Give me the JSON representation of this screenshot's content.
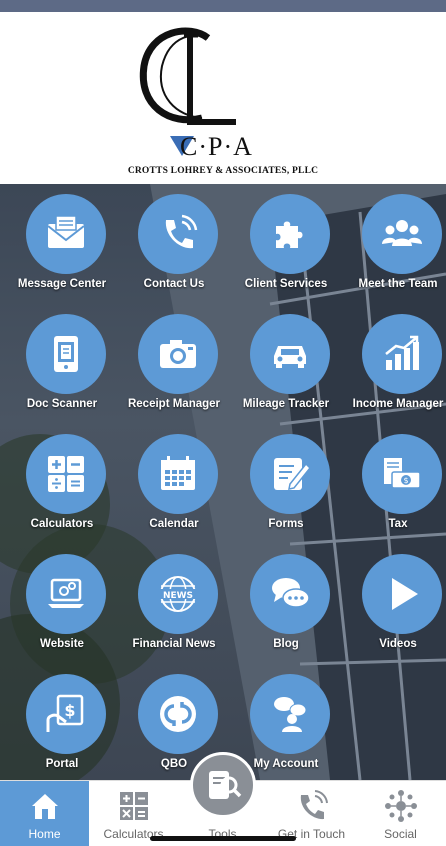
{
  "header": {
    "logo_monogram": "CL",
    "logo_cpa": "C·P·A",
    "firm_name": "CROTTS LOHREY & ASSOCIATES, PLLC"
  },
  "tiles": [
    {
      "label": "Message Center",
      "icon": "envelope-icon"
    },
    {
      "label": "Contact Us",
      "icon": "phone-icon"
    },
    {
      "label": "Client Services",
      "icon": "puzzle-icon"
    },
    {
      "label": "Meet the Team",
      "icon": "people-icon"
    },
    {
      "label": "Doc Scanner",
      "icon": "doc-scanner-icon"
    },
    {
      "label": "Receipt Manager",
      "icon": "camera-icon"
    },
    {
      "label": "Mileage Tracker",
      "icon": "car-icon"
    },
    {
      "label": "Income Manager",
      "icon": "growth-chart-icon"
    },
    {
      "label": "Calculators",
      "icon": "calculator-icon"
    },
    {
      "label": "Calendar",
      "icon": "calendar-icon"
    },
    {
      "label": "Forms",
      "icon": "form-edit-icon"
    },
    {
      "label": "Tax",
      "icon": "money-icon"
    },
    {
      "label": "Website",
      "icon": "laptop-gear-icon"
    },
    {
      "label": "Financial News",
      "icon": "news-globe-icon"
    },
    {
      "label": "Blog",
      "icon": "chat-bubbles-icon"
    },
    {
      "label": "Videos",
      "icon": "play-icon"
    },
    {
      "label": "Portal",
      "icon": "portal-dollar-icon"
    },
    {
      "label": "QBO",
      "icon": "qbo-icon"
    },
    {
      "label": "My Account",
      "icon": "account-icon"
    }
  ],
  "tabbar": {
    "items": [
      {
        "label": "Home",
        "icon": "home-icon",
        "active": true
      },
      {
        "label": "Calculators",
        "icon": "calculator-icon",
        "active": false
      },
      {
        "label": "Tools",
        "icon": "tools-icon",
        "active": false
      },
      {
        "label": "Get in Touch",
        "icon": "phone-icon",
        "active": false
      },
      {
        "label": "Social",
        "icon": "social-network-icon",
        "active": false
      }
    ]
  },
  "colors": {
    "accent": "#5d9ad6",
    "logo_triangle": "#3a6db5",
    "top_bar": "#5d6a86"
  }
}
